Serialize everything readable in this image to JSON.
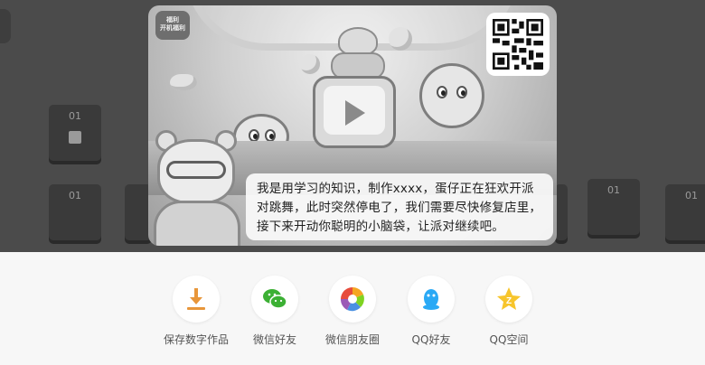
{
  "background": {
    "tiles": [
      "01",
      "01",
      "01",
      "01",
      "01"
    ]
  },
  "card": {
    "badge_line1": "福利",
    "badge_line2": "开机福利",
    "story_text": "我是用学习的知识，制作xxxx，蛋仔正在狂欢开派对跳舞，此时突然停电了，我们需要尽快修复店里，接下来开动你聪明的小脑袋，让派对继续吧。"
  },
  "share": {
    "items": [
      {
        "label": "保存数字作品",
        "icon": "download-icon",
        "color": "#e8963a"
      },
      {
        "label": "微信好友",
        "icon": "wechat-icon",
        "color": "#3cb034"
      },
      {
        "label": "微信朋友圈",
        "icon": "moments-icon",
        "color": "#4a90e2"
      },
      {
        "label": "QQ好友",
        "icon": "qq-icon",
        "color": "#2aa9f5"
      },
      {
        "label": "QQ空间",
        "icon": "qzone-icon",
        "color": "#f7c52c"
      }
    ]
  }
}
